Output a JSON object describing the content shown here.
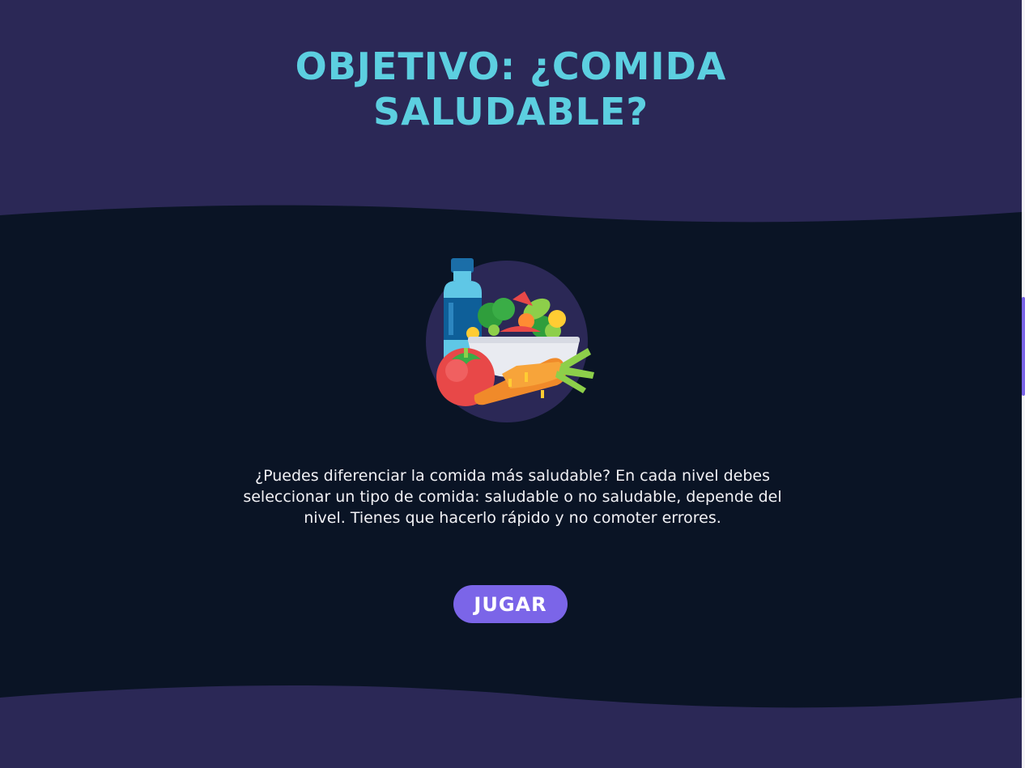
{
  "header": {
    "title_line1": "OBJETIVO: ¿COMIDA",
    "title_line2": "SALUDABLE?"
  },
  "main": {
    "illustration_icon": "healthy-food-icon",
    "description": "¿Puedes diferenciar la comida más saludable? En cada nivel debes seleccionar un tipo de comida: saludable o no saludable, depende del nivel. Tienes que hacerlo rápido y no comoter errores.",
    "play_button_label": "JUGAR"
  },
  "colors": {
    "page_background": "#2b2856",
    "section_background": "#0a1425",
    "title": "#5ccfe0",
    "button": "#7b65e8",
    "text": "#f1f1f5"
  }
}
